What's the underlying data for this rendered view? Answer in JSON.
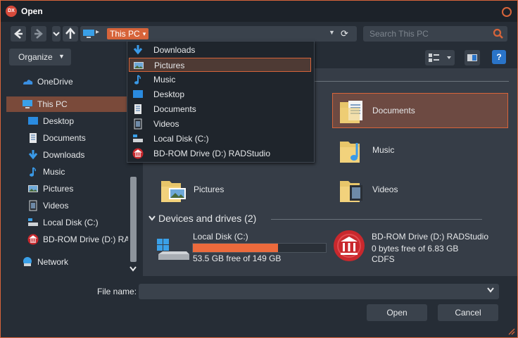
{
  "window": {
    "title": "Open",
    "app_icon_text": "DX"
  },
  "address_bar": {
    "crumb": "This PC"
  },
  "search": {
    "placeholder": "Search This PC"
  },
  "toolbar": {
    "organize_label": "Organize",
    "help_label": "?"
  },
  "sidebar": {
    "items": [
      {
        "label": "OneDrive",
        "icon": "cloud-icon"
      },
      {
        "label": "This PC",
        "icon": "computer-icon",
        "selected": true
      },
      {
        "label": "Desktop",
        "icon": "desktop-icon"
      },
      {
        "label": "Documents",
        "icon": "documents-icon"
      },
      {
        "label": "Downloads",
        "icon": "download-icon"
      },
      {
        "label": "Music",
        "icon": "music-icon"
      },
      {
        "label": "Pictures",
        "icon": "pictures-icon"
      },
      {
        "label": "Videos",
        "icon": "videos-icon"
      },
      {
        "label": "Local Disk (C:)",
        "icon": "disk-icon"
      },
      {
        "label": "BD-ROM Drive (D:) RAD",
        "icon": "bd-rom-icon"
      },
      {
        "label": "Network",
        "icon": "network-icon"
      }
    ]
  },
  "folders": [
    {
      "label": "Documents",
      "selected": true
    },
    {
      "label": "Music"
    },
    {
      "label": "Pictures"
    },
    {
      "label": "Videos"
    }
  ],
  "devices": {
    "group_label": "Devices and drives (2)",
    "drives": [
      {
        "name": "Local Disk (C:)",
        "free_text": "53.5 GB free of 149 GB",
        "used_fraction": 0.64
      },
      {
        "name": "BD-ROM Drive (D:) RADStudio",
        "free_text": "0 bytes free of 6.83 GB",
        "fs": "CDFS"
      }
    ]
  },
  "dropdown": {
    "items": [
      {
        "label": "Downloads",
        "icon": "download-icon"
      },
      {
        "label": "Pictures",
        "icon": "pictures-icon",
        "selected": true
      },
      {
        "label": "Music",
        "icon": "music-icon"
      },
      {
        "label": "Desktop",
        "icon": "desktop-icon"
      },
      {
        "label": "Documents",
        "icon": "documents-icon"
      },
      {
        "label": "Videos",
        "icon": "videos-icon"
      },
      {
        "label": "Local Disk (C:)",
        "icon": "disk-icon"
      },
      {
        "label": "BD-ROM Drive (D:) RADStudio",
        "icon": "bd-rom-icon"
      }
    ]
  },
  "bottom": {
    "file_name_label": "File name:",
    "file_name_value": "",
    "open_label": "Open",
    "cancel_label": "Cancel"
  },
  "colors": {
    "accent": "#d7643a",
    "background": "#262d36",
    "pane": "#363d47",
    "bar_fill": "#ec6a3c"
  }
}
